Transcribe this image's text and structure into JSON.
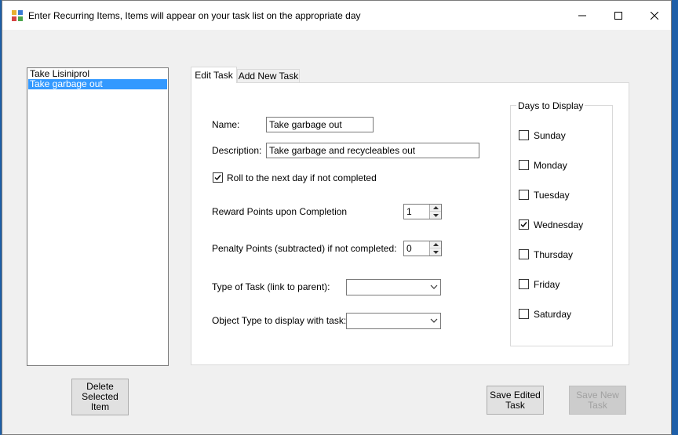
{
  "window": {
    "title": "Enter Recurring Items, Items will appear on your task list on the appropriate day"
  },
  "task_list": {
    "items": [
      {
        "label": "Take Lisiniprol",
        "selected": false
      },
      {
        "label": "Take garbage out",
        "selected": true
      }
    ]
  },
  "buttons": {
    "delete_selected": "Delete Selected Item",
    "save_edited": "Save Edited Task",
    "save_new": "Save New Task"
  },
  "tabs": [
    {
      "label": "Edit Task",
      "active": true
    },
    {
      "label": "Add New Task",
      "active": false
    }
  ],
  "form": {
    "name_label": "Name:",
    "name_value": "Take garbage out",
    "description_label": "Description:",
    "description_value": "Take garbage and recycleables out",
    "roll_label": "Roll to the next day if not completed",
    "roll_checked": true,
    "reward_label": "Reward Points upon Completion",
    "reward_value": "1",
    "penalty_label": "Penalty Points (subtracted) if not completed:",
    "penalty_value": "0",
    "type_label": "Type of Task (link to parent):",
    "type_value": "",
    "object_label": "Object Type to display with task:",
    "object_value": ""
  },
  "days": {
    "title": "Days to Display",
    "items": [
      {
        "label": "Sunday",
        "checked": false
      },
      {
        "label": "Monday",
        "checked": false
      },
      {
        "label": "Tuesday",
        "checked": false
      },
      {
        "label": "Wednesday",
        "checked": true
      },
      {
        "label": "Thursday",
        "checked": false
      },
      {
        "label": "Friday",
        "checked": false
      },
      {
        "label": "Saturday",
        "checked": false
      }
    ]
  },
  "colors": {
    "selection": "#3399ff",
    "desktop": "#1e5fa8"
  }
}
